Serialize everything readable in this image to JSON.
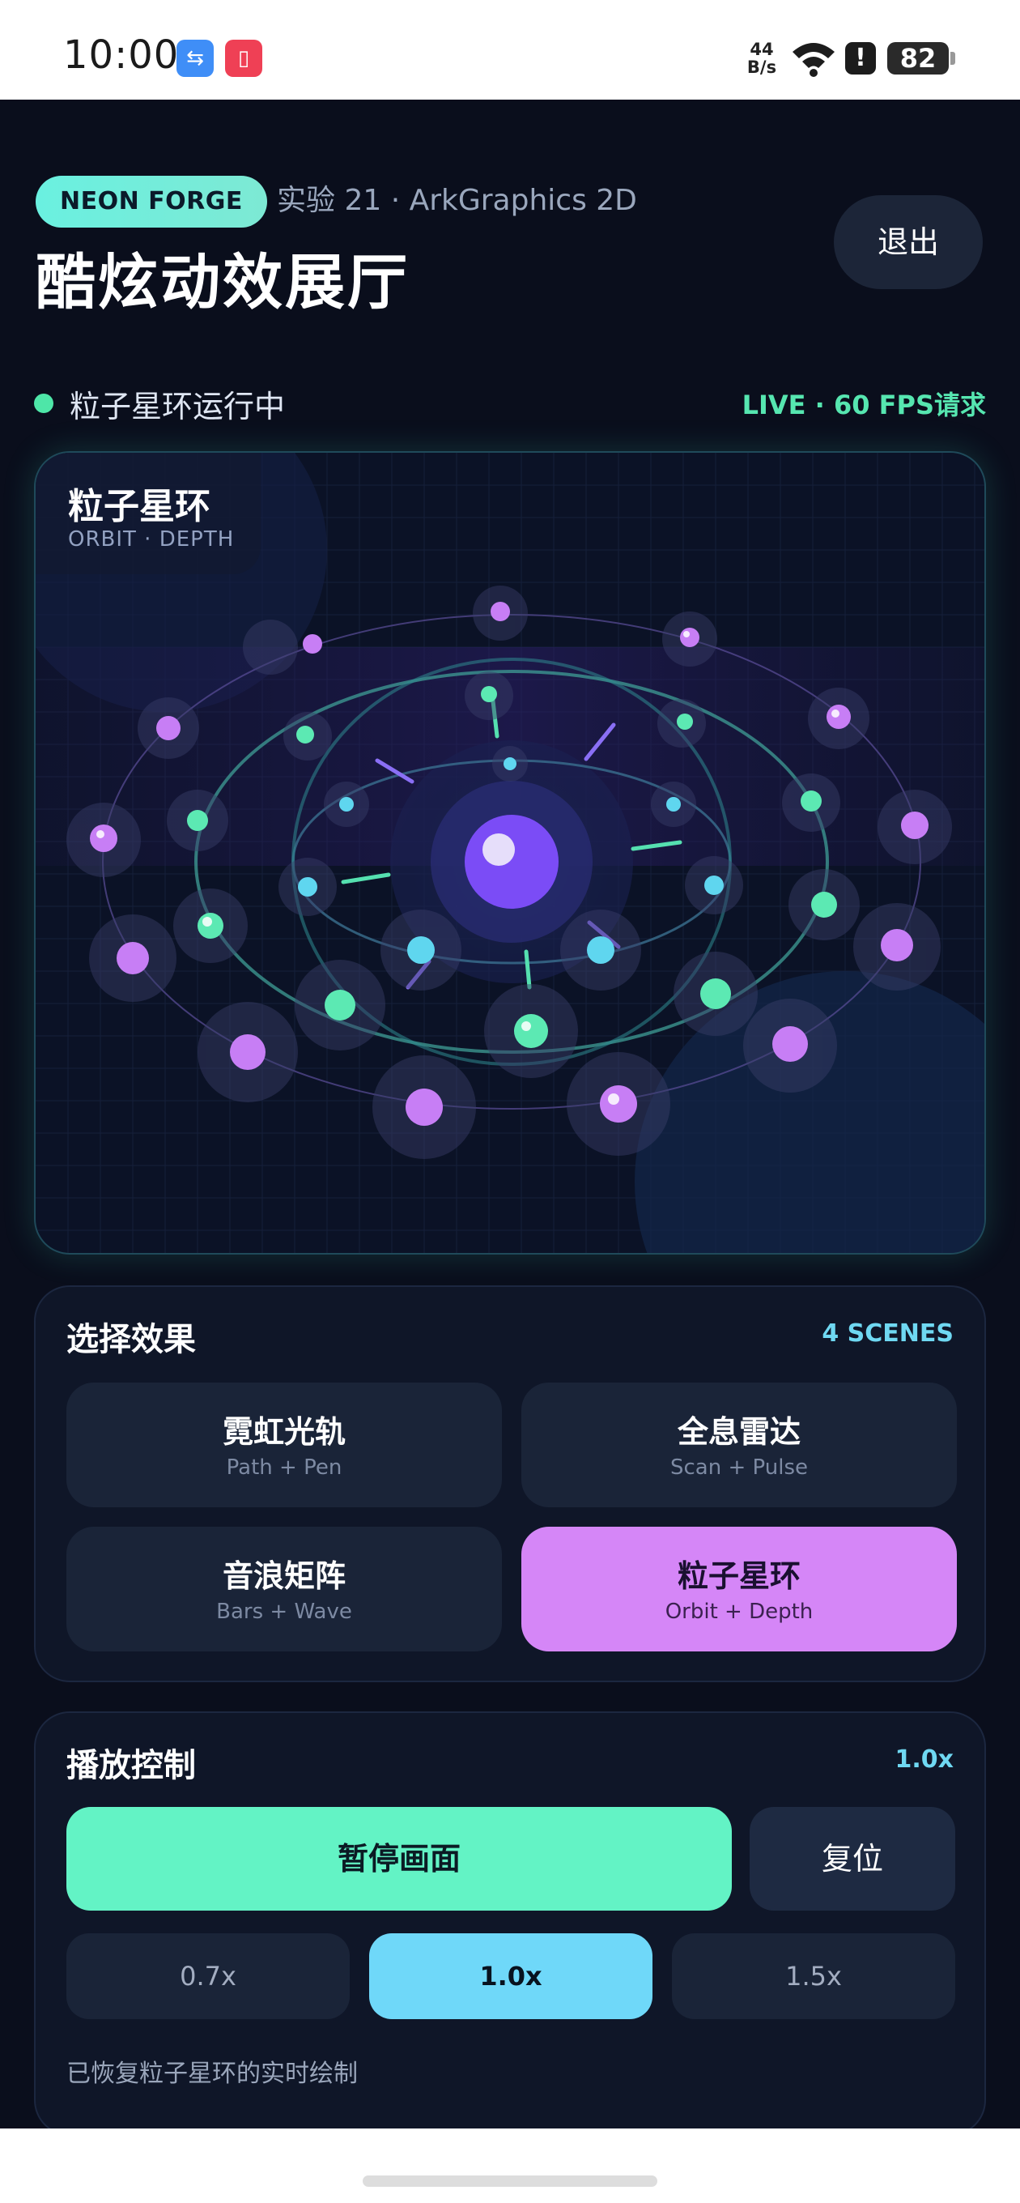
{
  "status_bar": {
    "time": "10:00",
    "net_speed_value": "44",
    "net_speed_unit": "B/s",
    "battery": "82",
    "alert": "!",
    "icons": [
      "usb-icon",
      "book-app-icon",
      "wifi-icon",
      "alert-icon",
      "battery-icon"
    ]
  },
  "header": {
    "badge": "NEON FORGE",
    "subtitle": "实验 21 · ArkGraphics 2D",
    "title": "酷炫动效展厅",
    "exit_label": "退出"
  },
  "status": {
    "text": "粒子星环运行中",
    "live": "LIVE · 60 FPS请求",
    "dot_color": "#4ee6a8"
  },
  "canvas": {
    "scene_title": "粒子星环",
    "scene_subtitle": "ORBIT · DEPTH",
    "colors": {
      "core": "#7b4cf6",
      "ring_green": "#55e0b0",
      "ring_cyan": "#5fd6ef",
      "ring_purple": "#c77ef5"
    }
  },
  "effects_panel": {
    "title": "选择效果",
    "meta": "4 SCENES",
    "items": [
      {
        "name": "霓虹光轨",
        "sub": "Path + Pen",
        "active": false
      },
      {
        "name": "全息雷达",
        "sub": "Scan + Pulse",
        "active": false
      },
      {
        "name": "音浪矩阵",
        "sub": "Bars + Wave",
        "active": false
      },
      {
        "name": "粒子星环",
        "sub": "Orbit + Depth",
        "active": true
      }
    ]
  },
  "playback_panel": {
    "title": "播放控制",
    "meta": "1.0x",
    "pause_label": "暂停画面",
    "reset_label": "复位",
    "speeds": [
      "0.7x",
      "1.0x",
      "1.5x"
    ],
    "selected_speed": "1.0x",
    "note": "已恢复粒子星环的实时绘制"
  },
  "accent_colors": {
    "mint": "#63f3c5",
    "cyan": "#6fd8f9",
    "purple": "#d586f7",
    "background": "#0a0e1c"
  }
}
